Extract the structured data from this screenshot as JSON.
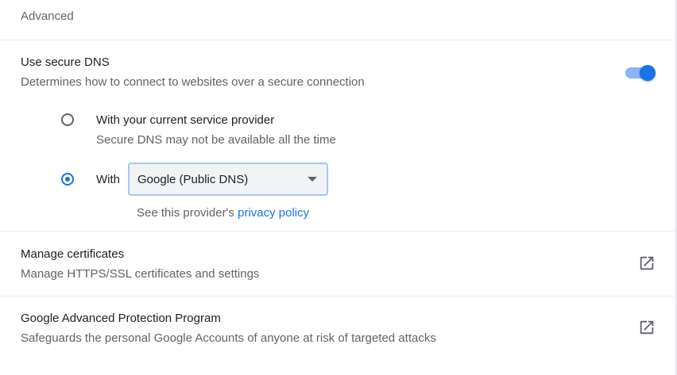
{
  "section": {
    "title": "Advanced"
  },
  "secure_dns": {
    "title": "Use secure DNS",
    "description": "Determines how to connect to websites over a secure connection",
    "toggle_on": true,
    "accent_color": "#1a73e8",
    "option_current": {
      "label": "With your current service provider",
      "description": "Secure DNS may not be available all the time",
      "selected": false
    },
    "option_custom": {
      "label": "With",
      "selected": true,
      "dropdown_value": "Google (Public DNS)",
      "provider_note_prefix": "See this provider's",
      "provider_link": "privacy policy"
    }
  },
  "manage_certificates": {
    "title": "Manage certificates",
    "description": "Manage HTTPS/SSL certificates and settings",
    "icon": "open-in-new-icon"
  },
  "advanced_protection": {
    "title": "Google Advanced Protection Program",
    "description": "Safeguards the personal Google Accounts of anyone at risk of targeted attacks",
    "icon": "open-in-new-icon"
  }
}
